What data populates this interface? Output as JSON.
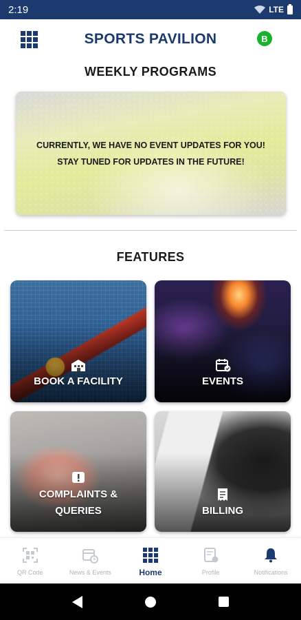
{
  "status_bar": {
    "time": "2:19",
    "network": "LTE"
  },
  "header": {
    "title": "SPORTS PAVILION",
    "badge": "B"
  },
  "weekly": {
    "title": "WEEKLY PROGRAMS",
    "banner_line1": "CURRENTLY, WE HAVE NO EVENT UPDATES FOR YOU!",
    "banner_line2": "STAY TUNED FOR UPDATES IN THE FUTURE!"
  },
  "features": {
    "title": "FEATURES",
    "cards": [
      {
        "label": "BOOK A FACILITY",
        "icon": "building-icon"
      },
      {
        "label": "EVENTS",
        "icon": "calendar-check-icon"
      },
      {
        "label_line1": "COMPLAINTS &",
        "label_line2": "QUERIES",
        "icon": "alert-icon"
      },
      {
        "label": "BILLING",
        "icon": "receipt-icon"
      }
    ]
  },
  "nav": [
    {
      "label": "QR Code",
      "icon": "qr-scan-icon"
    },
    {
      "label": "News & Events",
      "icon": "calendar-clock-icon"
    },
    {
      "label": "Home",
      "icon": "home-grid-icon",
      "active": true
    },
    {
      "label": "Profile",
      "icon": "profile-icon"
    },
    {
      "label": "Notifications",
      "icon": "bell-icon"
    }
  ],
  "colors": {
    "primary": "#1c3a6e",
    "badge": "#17b32c",
    "inactive": "#b3b3b3"
  }
}
